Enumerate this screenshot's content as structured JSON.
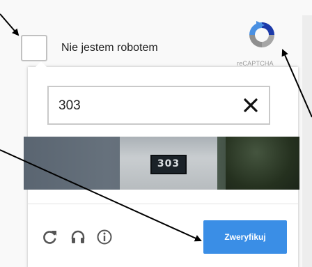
{
  "anchor": {
    "label": "Nie jestem robotem",
    "logo_text": "reCAPTCHA",
    "logo_icon": "recaptcha-logo-icon"
  },
  "challenge": {
    "answer_value": "303",
    "clear_icon": "close-icon",
    "image_text": "303"
  },
  "controls": {
    "reload_icon": "reload-icon",
    "audio_icon": "headphones-icon",
    "info_icon": "info-icon",
    "verify_label": "Zweryfikuj"
  },
  "colors": {
    "verify_button": "#3a8ee6",
    "checkbox_border": "#c1c1c1",
    "icon_gray": "#555555",
    "arrow": "#000000"
  }
}
